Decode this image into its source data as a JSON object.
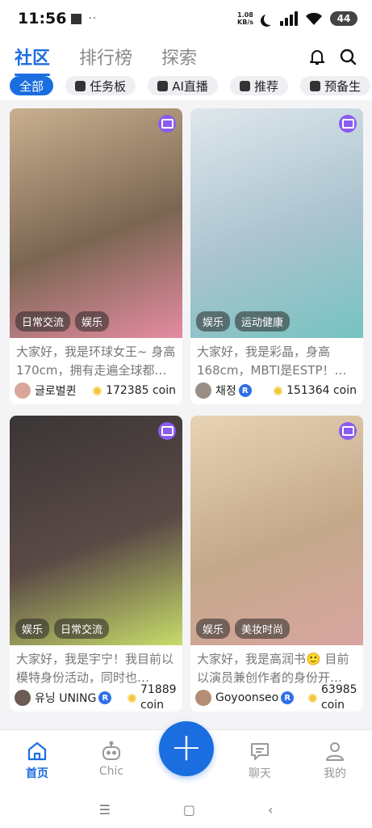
{
  "status_bar": {
    "time": "11:56",
    "net_speed_value": "1.08",
    "net_speed_unit": "KB/s",
    "battery": "44"
  },
  "header": {
    "tabs": [
      {
        "label": "社区"
      },
      {
        "label": "排行榜"
      },
      {
        "label": "探索"
      }
    ]
  },
  "chips": [
    {
      "label": "全部"
    },
    {
      "label": "任务板"
    },
    {
      "label": "AI直播"
    },
    {
      "label": "推荐"
    },
    {
      "label": "预备生"
    }
  ],
  "posts": [
    {
      "tags": [
        "日常交流",
        "娱乐"
      ],
      "text": "大家好，我是环球女王~ 身高170cm，拥有走遍全球都…",
      "user": "글로벌퀸",
      "verified": false,
      "coins": "172385 coin",
      "avatar_color": "#d9a79a",
      "photo_colors": [
        "#c9b08f",
        "#7b6652",
        "#e58ba2"
      ]
    },
    {
      "tags": [
        "娱乐",
        "运动健康"
      ],
      "text": "大家好，我是彩晶，身高168cm，MBTI是ESTP！…",
      "user": "채정",
      "verified": true,
      "coins": "151364 coin",
      "avatar_color": "#9a8f86",
      "photo_colors": [
        "#dfe7ec",
        "#aac3cf",
        "#76c3c0"
      ]
    },
    {
      "tags": [
        "娱乐",
        "日常交流"
      ],
      "text": "大家好，我是宇宁！我目前以模特身份活动，同时也…",
      "user": "유닝 UNING",
      "verified": true,
      "coins": "71889 coin",
      "avatar_color": "#6b5b55",
      "photo_colors": [
        "#3a3536",
        "#5b4a46",
        "#c7dc6a"
      ]
    },
    {
      "tags": [
        "娱乐",
        "美妆时尚"
      ],
      "text": "大家好，我是高润书🙂 目前以演员兼创作者的身份开…",
      "user": "Goyoonseo",
      "verified": true,
      "coins": "63985 coin",
      "avatar_color": "#b38e74",
      "photo_colors": [
        "#e8d3b5",
        "#c4a88a",
        "#d8a5a0"
      ]
    }
  ],
  "bottom_nav": [
    {
      "label": "首页"
    },
    {
      "label": "Chic"
    },
    {
      "label": "聊天"
    },
    {
      "label": "我的"
    }
  ],
  "colors": {
    "accent": "#1b6ee0",
    "badge": "#8a5cf0",
    "coin": "#f4c542"
  }
}
